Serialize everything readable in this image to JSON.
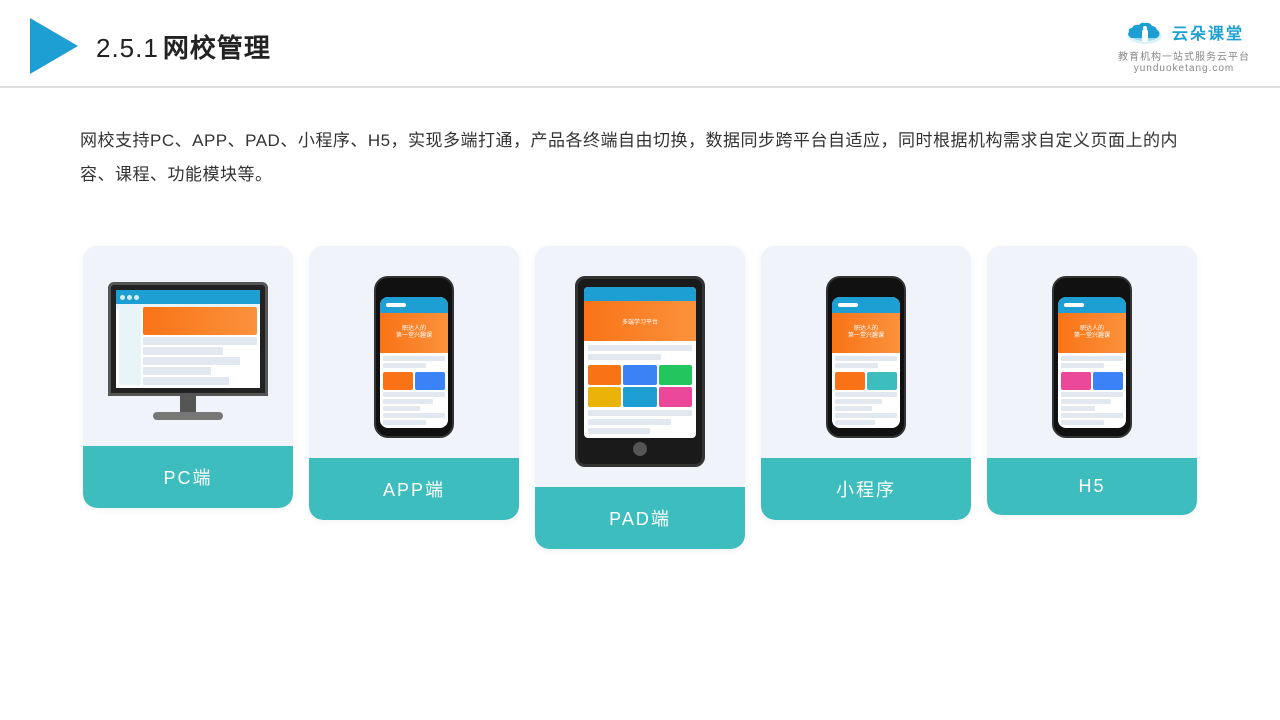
{
  "header": {
    "section_number": "2.5.1",
    "title": "网校管理",
    "brand_name": "云朵课堂",
    "brand_url": "yunduoketang.com",
    "brand_tagline": "教育机构一站式服务云平台"
  },
  "description": {
    "text": "网校支持PC、APP、PAD、小程序、H5，实现多端打通，产品各终端自由切换，数据同步跨平台自适应，同时根据机构需求自定义页面上的内容、课程、功能模块等。"
  },
  "cards": [
    {
      "id": "pc",
      "label": "PC端",
      "type": "monitor"
    },
    {
      "id": "app",
      "label": "APP端",
      "type": "phone"
    },
    {
      "id": "pad",
      "label": "PAD端",
      "type": "tablet"
    },
    {
      "id": "miniprogram",
      "label": "小程序",
      "type": "phone"
    },
    {
      "id": "h5",
      "label": "H5",
      "type": "phone"
    }
  ],
  "colors": {
    "teal": "#3dbdbd",
    "blue": "#1e9fd4",
    "orange": "#f97316",
    "bg_card": "#f0f4fa"
  }
}
